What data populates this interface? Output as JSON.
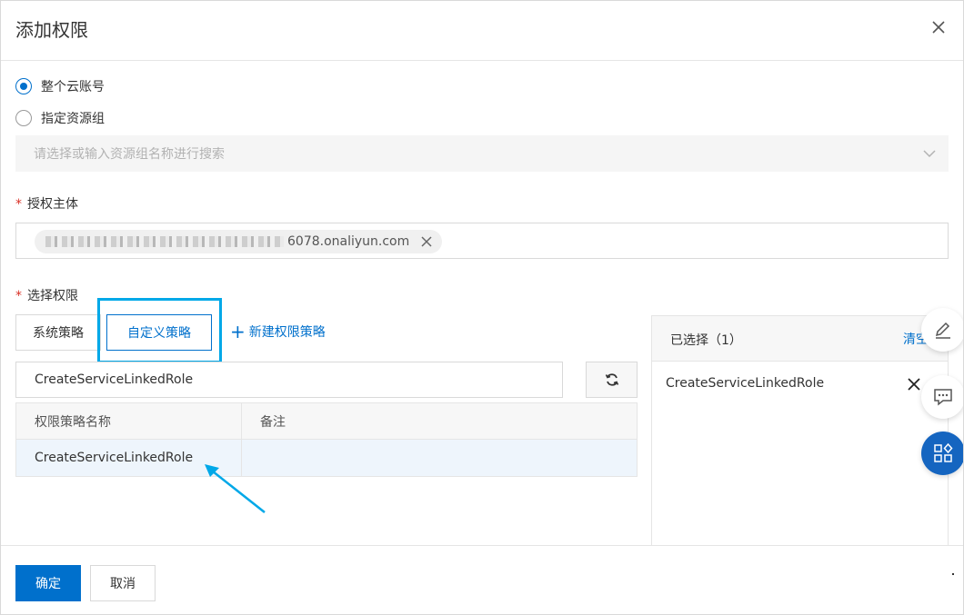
{
  "dialog": {
    "title": "添加权限"
  },
  "scope": {
    "option_whole_account": "整个云账号",
    "option_resource_group": "指定资源组",
    "resource_group_placeholder": "请选择或输入资源组名称进行搜索",
    "selected": "whole_account"
  },
  "principal": {
    "label": "授权主体",
    "required_mark": "*",
    "tag_suffix": "6078.onaliyun.com"
  },
  "permissions": {
    "label": "选择权限",
    "required_mark": "*",
    "tab_system": "系统策略",
    "tab_custom": "自定义策略",
    "active_tab": "custom",
    "new_policy_plus": "+",
    "new_policy_label": "新建权限策略",
    "search_value": "CreateServiceLinkedRole",
    "table": {
      "headers": [
        "权限策略名称",
        "备注"
      ],
      "rows": [
        {
          "name": "CreateServiceLinkedRole",
          "note": ""
        }
      ]
    }
  },
  "selected_panel": {
    "title": "已选择（1）",
    "clear_label": "清空",
    "items": [
      "CreateServiceLinkedRole"
    ]
  },
  "footer": {
    "ok_label": "确定",
    "cancel_label": "取消"
  },
  "colors": {
    "accent": "#0070cc",
    "highlight": "#00a8e8",
    "float_blue": "#1565c0"
  },
  "icons": {
    "close": "close-icon",
    "chevron": "chevron-down-icon",
    "refresh": "refresh-icon",
    "edit": "pencil-icon",
    "feedback": "chat-icon",
    "apps": "apps-icon"
  }
}
